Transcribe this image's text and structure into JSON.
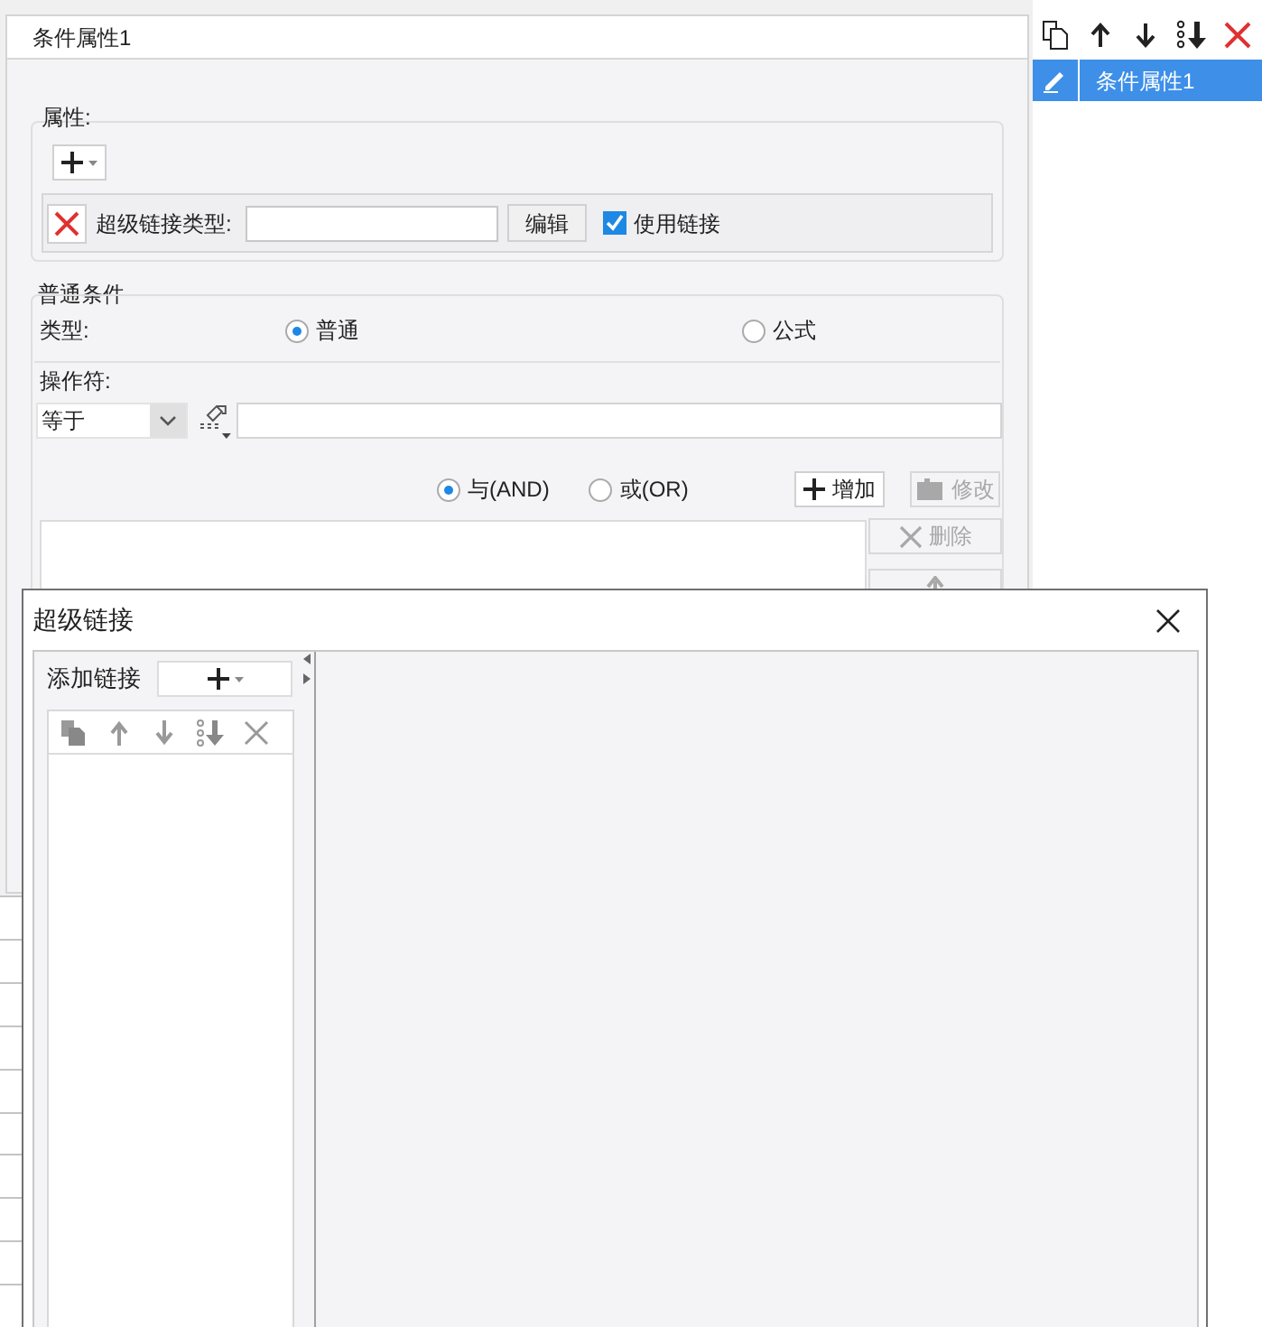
{
  "condition_dialog": {
    "title": "条件属性1",
    "properties_label": "属性:",
    "hyperlink_type_label": "超级链接类型:",
    "edit_button": "编辑",
    "use_link": {
      "label": "使用链接",
      "checked": true
    },
    "general_condition": {
      "title": "普通条件",
      "type_label": "类型:",
      "type_options": [
        {
          "label": "普通",
          "selected": true
        },
        {
          "label": "公式",
          "selected": false
        }
      ],
      "operator_label": "操作符:",
      "operator_value": "等于",
      "logic_options": [
        {
          "label": "与(AND)",
          "selected": true
        },
        {
          "label": "或(OR)",
          "selected": false
        }
      ],
      "buttons": [
        {
          "label": "增加",
          "disabled": false
        },
        {
          "label": "修改",
          "disabled": true
        },
        {
          "label": "删除",
          "disabled": true
        },
        {
          "disabled": true
        }
      ]
    }
  },
  "conditions_list": {
    "items": [
      {
        "label": "条件属性1",
        "selected": true
      }
    ]
  },
  "hyperlink_dialog": {
    "title": "超级链接",
    "add_link_label": "添加链接"
  }
}
